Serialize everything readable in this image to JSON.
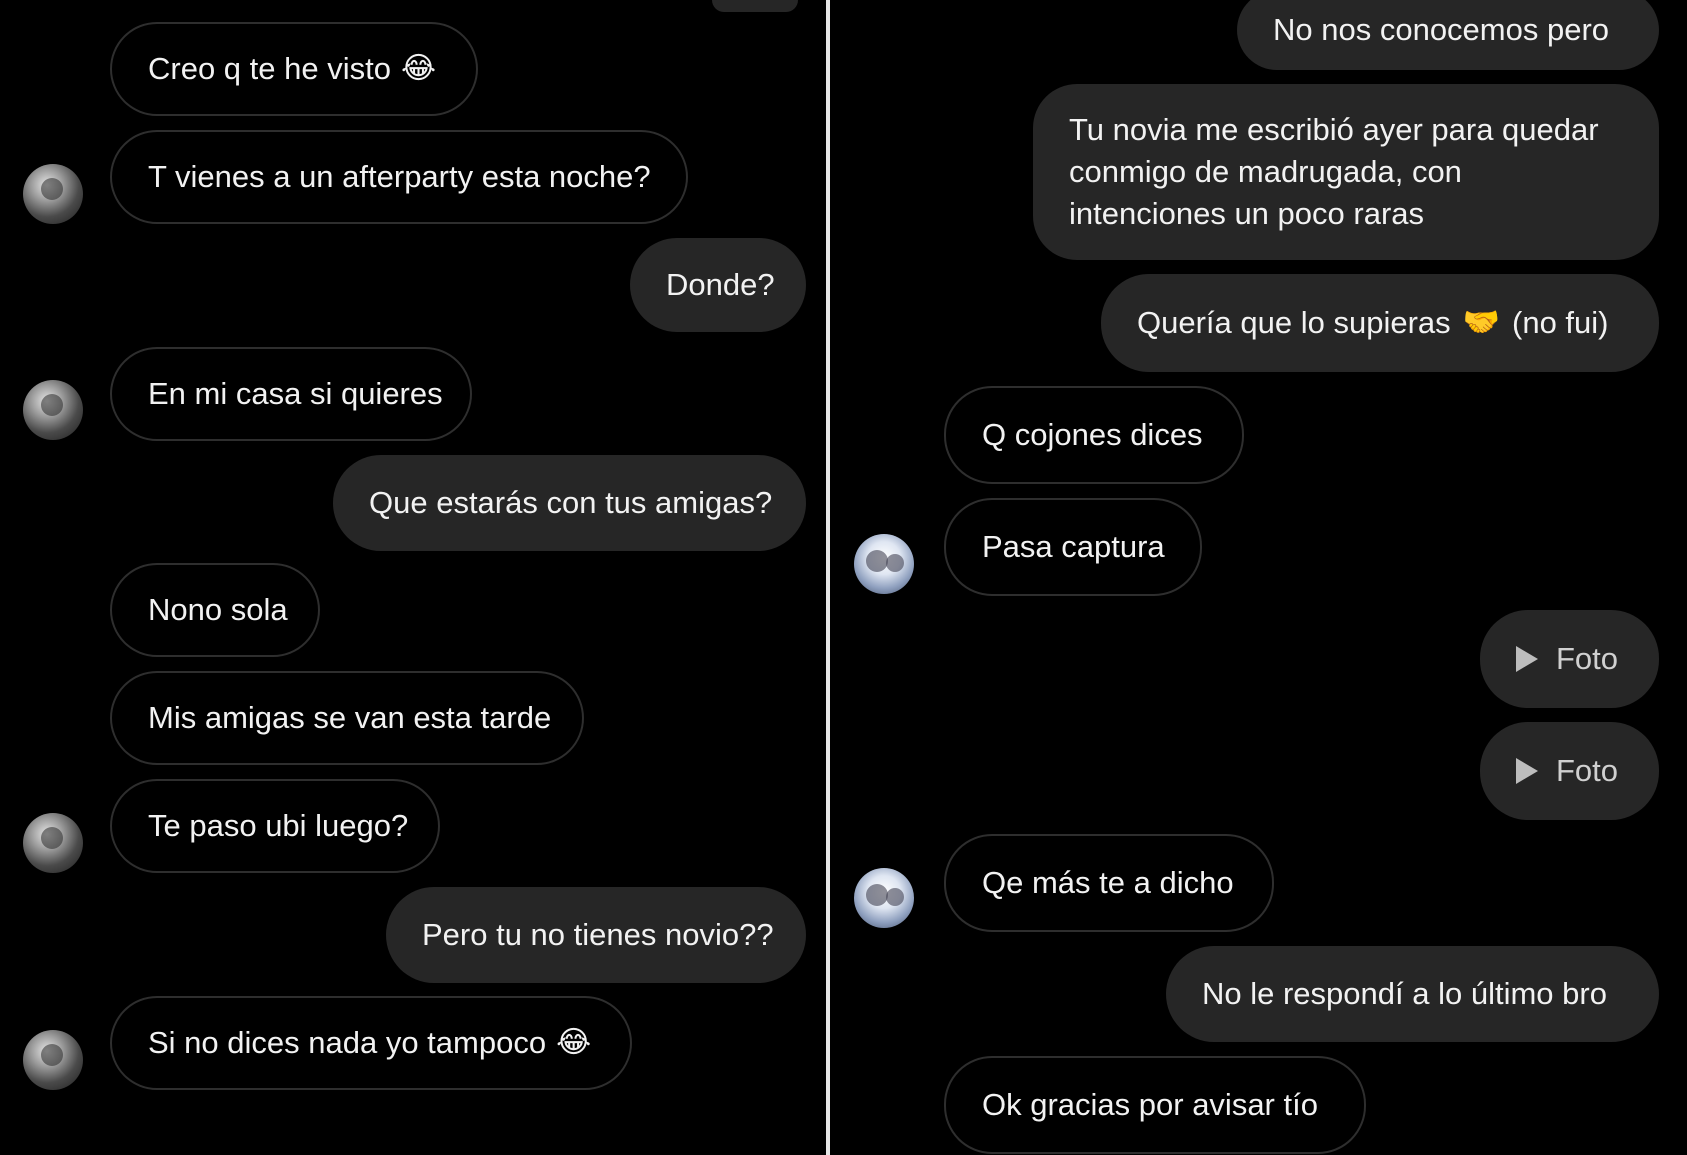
{
  "left_panel": {
    "messages": [
      {
        "id": "l1",
        "side": "in",
        "text": "Creo q te he visto",
        "emoji": "😂"
      },
      {
        "id": "l2",
        "side": "in",
        "text": "T vienes a un afterparty esta noche?"
      },
      {
        "id": "l3",
        "side": "out",
        "text": "Donde?"
      },
      {
        "id": "l4",
        "side": "in",
        "text": "En mi casa si quieres"
      },
      {
        "id": "l5",
        "side": "out",
        "text": "Que estarás con tus amigas?"
      },
      {
        "id": "l6",
        "side": "in",
        "text": "Nono sola"
      },
      {
        "id": "l7",
        "side": "in",
        "text": "Mis amigas se van esta tarde"
      },
      {
        "id": "l8",
        "side": "in",
        "text": "Te paso ubi luego?"
      },
      {
        "id": "l9",
        "side": "out",
        "text": "Pero tu no tienes novio??"
      },
      {
        "id": "l10",
        "side": "in",
        "text": "Si no dices nada yo tampoco",
        "emoji": "😂"
      }
    ]
  },
  "right_panel": {
    "messages": [
      {
        "id": "r1",
        "side": "out",
        "text": "No nos conocemos pero"
      },
      {
        "id": "r2",
        "side": "out",
        "text": "Tu novia me escribió ayer para quedar conmigo de madrugada, con intenciones un poco raras"
      },
      {
        "id": "r3",
        "side": "out",
        "text": "Quería que lo supieras",
        "emoji": "🤝",
        "suffix": "(no fui)"
      },
      {
        "id": "r4",
        "side": "in",
        "text": "Q cojones dices"
      },
      {
        "id": "r5",
        "side": "in",
        "text": "Pasa captura"
      },
      {
        "id": "r6",
        "side": "out",
        "text": "Foto",
        "icon": "play-icon"
      },
      {
        "id": "r7",
        "side": "out",
        "text": "Foto",
        "icon": "play-icon"
      },
      {
        "id": "r8",
        "side": "in",
        "text": "Qe más te a dicho"
      },
      {
        "id": "r9",
        "side": "out",
        "text": "No le respondí a lo último bro"
      },
      {
        "id": "r10",
        "side": "in",
        "text": "Ok gracias por avisar tío"
      }
    ]
  },
  "colors": {
    "background": "#000000",
    "outgoing_bubble": "#262626",
    "incoming_border": "#2e2e2e",
    "text": "#f2f2f2",
    "divider": "#e6e6e6"
  }
}
